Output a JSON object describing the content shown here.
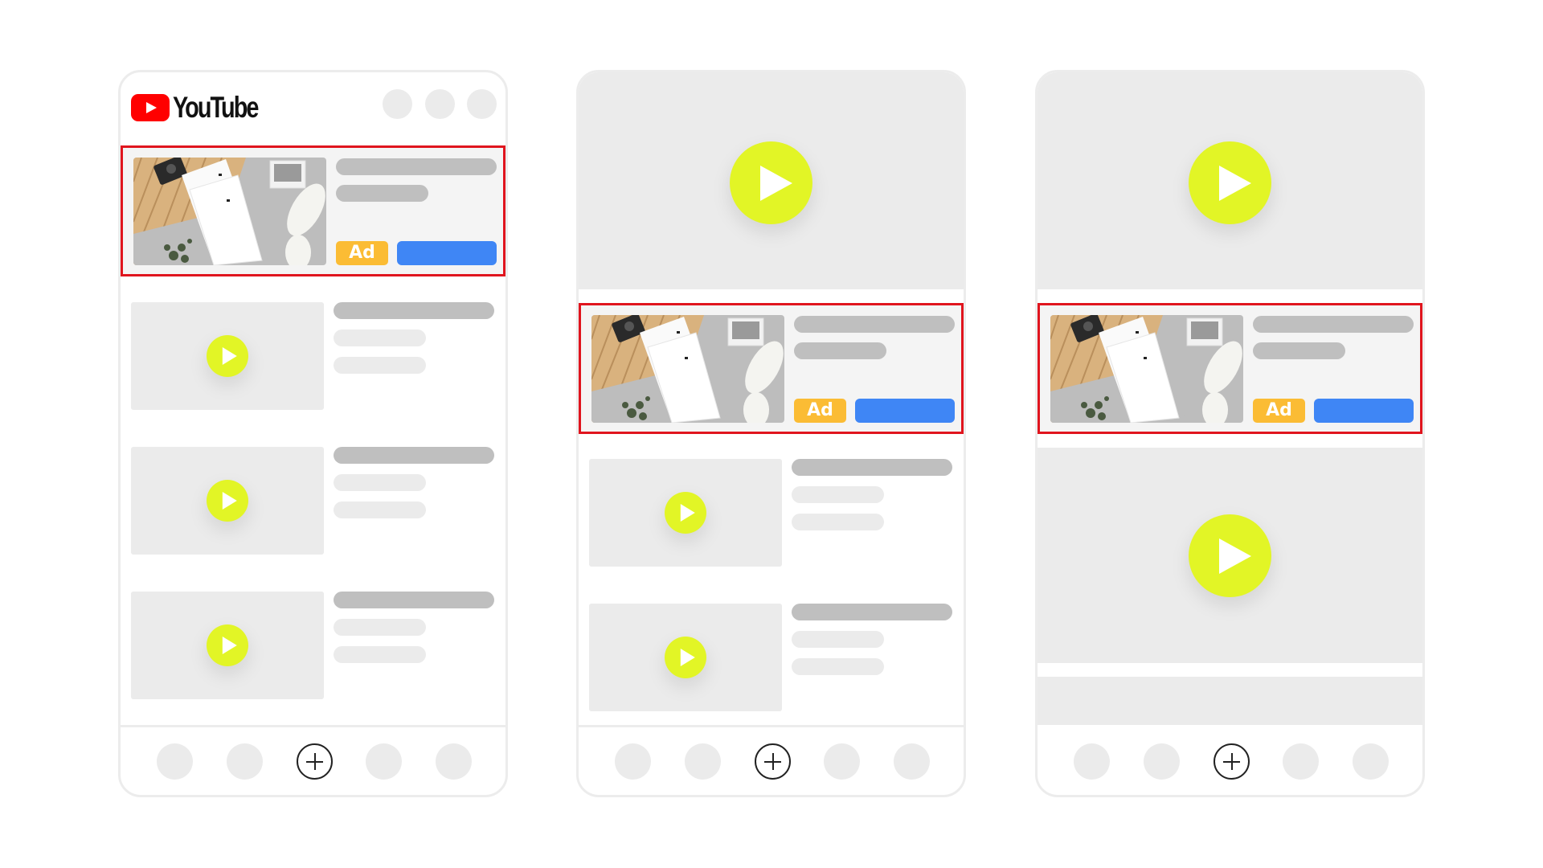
{
  "app": {
    "brand_name": "YouTube",
    "brand_color": "#ff0000"
  },
  "colors": {
    "highlight_border": "#e0151e",
    "ad_badge": "#fbbc34",
    "cta_button": "#3f86f5",
    "play_button": "#e2f526",
    "placeholder_dark": "#bfbfbf",
    "placeholder_light": "#ebebeb"
  },
  "ad": {
    "badge_label": "Ad",
    "thumbnail_description": "Folded white T-shirts on wood and grey mat with camera, photo card, plant and white sneakers",
    "cta_label": ""
  },
  "phones": [
    {
      "name": "home-feed",
      "header": {
        "logo": "YouTube",
        "icons": [
          "header-icon-1",
          "header-icon-2",
          "header-icon-3"
        ]
      },
      "ad_position": "top-of-feed",
      "feed_items": 3
    },
    {
      "name": "watch-page",
      "hero_video": "playing-video",
      "ad_position": "below-video",
      "feed_items": 2
    },
    {
      "name": "watch-page-next",
      "hero_video": "playing-video",
      "ad_position": "between-videos",
      "feed_items": 1
    }
  ],
  "bottom_nav": {
    "items": [
      "nav-item-1",
      "nav-item-2",
      "create",
      "nav-item-4",
      "nav-item-5"
    ],
    "create_icon": "plus-circle-icon"
  }
}
